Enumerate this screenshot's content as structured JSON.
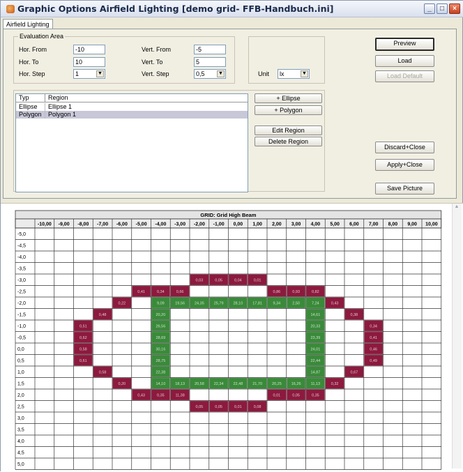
{
  "window": {
    "title": "Graphic Options Airfield Lighting [demo grid- FFB-Handbuch.ini]"
  },
  "tab": "Airfield Lighting",
  "evaluation": {
    "legend": "Evaluation Area",
    "hor_from_label": "Hor. From",
    "hor_from": "-10",
    "hor_to_label": "Hor. To",
    "hor_to": "10",
    "hor_step_label": "Hor. Step",
    "hor_step": "1",
    "vert_from_label": "Vert. From",
    "vert_from": "-5",
    "vert_to_label": "Vert. To",
    "vert_to": "5",
    "vert_step_label": "Vert. Step",
    "vert_step": "0,5",
    "unit_label": "Unit",
    "unit": "lx"
  },
  "regions": {
    "columns": [
      "Typ",
      "Region"
    ],
    "rows": [
      {
        "typ": "Ellipse",
        "region": "Ellipse 1",
        "selected": false
      },
      {
        "typ": "Polygon",
        "region": "Polygon 1",
        "selected": true
      }
    ],
    "add_ellipse": "+ Ellipse",
    "add_polygon": "+ Polygon",
    "edit_region": "Edit Region",
    "delete_region": "Delete Region"
  },
  "buttons": {
    "preview": "Preview",
    "load": "Load",
    "load_default": "Load Default",
    "discard_close": "Discard+Close",
    "apply_close": "Apply+Close",
    "save_picture": "Save Picture"
  },
  "icons": {
    "app": "app-icon",
    "minimize": "minimize-icon",
    "maximize": "maximize-icon",
    "close": "close-icon",
    "dropdown": "chevron-down-icon"
  },
  "colors": {
    "maroon": "#8c1a3e",
    "green": "#3a8a3a"
  },
  "grid": {
    "title": "GRID: Grid High Beam",
    "x_labels": [
      "-10,00",
      "-9,00",
      "-8,00",
      "-7,00",
      "-6,00",
      "-5,00",
      "-4,00",
      "-3,00",
      "-2,00",
      "-1,00",
      "0,00",
      "1,00",
      "2,00",
      "3,00",
      "4,00",
      "5,00",
      "6,00",
      "7,00",
      "8,00",
      "9,00",
      "10,00"
    ],
    "y_labels": [
      "-5,0",
      "-4,5",
      "-4,0",
      "-3,5",
      "-3,0",
      "-2,5",
      "-2,0",
      "-1,5",
      "-1,0",
      "-0,5",
      "0,0",
      "0,5",
      "1,0",
      "1,5",
      "2,0",
      "2,5",
      "3,0",
      "3,5",
      "4,0",
      "4,5",
      "5,0"
    ],
    "green_cells": [
      {
        "row": 6,
        "col": 6,
        "value": "9,09"
      },
      {
        "row": 6,
        "col": 7,
        "value": "19,56"
      },
      {
        "row": 6,
        "col": 8,
        "value": "24,35"
      },
      {
        "row": 6,
        "col": 9,
        "value": "25,79"
      },
      {
        "row": 6,
        "col": 10,
        "value": "28,10"
      },
      {
        "row": 6,
        "col": 11,
        "value": "17,81"
      },
      {
        "row": 6,
        "col": 12,
        "value": "9,34"
      },
      {
        "row": 6,
        "col": 13,
        "value": "2,50"
      },
      {
        "row": 6,
        "col": 14,
        "value": "7,24"
      },
      {
        "row": 7,
        "col": 6,
        "value": "20,20"
      },
      {
        "row": 7,
        "col": 14,
        "value": "14,61"
      },
      {
        "row": 8,
        "col": 6,
        "value": "26,56"
      },
      {
        "row": 8,
        "col": 14,
        "value": "20,33"
      },
      {
        "row": 9,
        "col": 6,
        "value": "28,69"
      },
      {
        "row": 9,
        "col": 14,
        "value": "23,39"
      },
      {
        "row": 10,
        "col": 6,
        "value": "30,16"
      },
      {
        "row": 10,
        "col": 14,
        "value": "24,01"
      },
      {
        "row": 11,
        "col": 6,
        "value": "28,75"
      },
      {
        "row": 11,
        "col": 14,
        "value": "22,44"
      },
      {
        "row": 12,
        "col": 6,
        "value": "22,38"
      },
      {
        "row": 12,
        "col": 14,
        "value": "14,87"
      },
      {
        "row": 13,
        "col": 6,
        "value": "14,10"
      },
      {
        "row": 13,
        "col": 7,
        "value": "18,13"
      },
      {
        "row": 13,
        "col": 8,
        "value": "20,58"
      },
      {
        "row": 13,
        "col": 9,
        "value": "22,34"
      },
      {
        "row": 13,
        "col": 10,
        "value": "22,48"
      },
      {
        "row": 13,
        "col": 11,
        "value": "21,70"
      },
      {
        "row": 13,
        "col": 12,
        "value": "20,25"
      },
      {
        "row": 13,
        "col": 13,
        "value": "16,26"
      },
      {
        "row": 13,
        "col": 14,
        "value": "11,13"
      }
    ],
    "maroon_cells": [
      {
        "row": 4,
        "col": 8,
        "value": "0,03"
      },
      {
        "row": 4,
        "col": 9,
        "value": "0,05"
      },
      {
        "row": 4,
        "col": 10,
        "value": "0,04"
      },
      {
        "row": 4,
        "col": 11,
        "value": "0,01"
      },
      {
        "row": 5,
        "col": 5,
        "value": "0,41"
      },
      {
        "row": 5,
        "col": 6,
        "value": "0,34"
      },
      {
        "row": 5,
        "col": 7,
        "value": "0,66"
      },
      {
        "row": 5,
        "col": 12,
        "value": "0,86"
      },
      {
        "row": 5,
        "col": 13,
        "value": "0,93"
      },
      {
        "row": 5,
        "col": 14,
        "value": "0,82"
      },
      {
        "row": 6,
        "col": 4,
        "value": "0,22"
      },
      {
        "row": 6,
        "col": 15,
        "value": "0,43"
      },
      {
        "row": 7,
        "col": 3,
        "value": "0,48"
      },
      {
        "row": 7,
        "col": 16,
        "value": "0,38"
      },
      {
        "row": 8,
        "col": 2,
        "value": "0,51"
      },
      {
        "row": 8,
        "col": 17,
        "value": "0,34"
      },
      {
        "row": 9,
        "col": 2,
        "value": "0,62"
      },
      {
        "row": 9,
        "col": 17,
        "value": "0,41"
      },
      {
        "row": 10,
        "col": 2,
        "value": "0,58"
      },
      {
        "row": 10,
        "col": 17,
        "value": "0,46"
      },
      {
        "row": 11,
        "col": 2,
        "value": "0,61"
      },
      {
        "row": 11,
        "col": 17,
        "value": "0,49"
      },
      {
        "row": 12,
        "col": 3,
        "value": "0,58"
      },
      {
        "row": 12,
        "col": 16,
        "value": "0,67"
      },
      {
        "row": 13,
        "col": 4,
        "value": "0,20"
      },
      {
        "row": 13,
        "col": 15,
        "value": "0,32"
      },
      {
        "row": 14,
        "col": 5,
        "value": "0,43"
      },
      {
        "row": 14,
        "col": 6,
        "value": "0,35"
      },
      {
        "row": 14,
        "col": 7,
        "value": "11,38"
      },
      {
        "row": 14,
        "col": 12,
        "value": "0,01"
      },
      {
        "row": 14,
        "col": 13,
        "value": "0,05"
      },
      {
        "row": 14,
        "col": 14,
        "value": "0,35"
      },
      {
        "row": 15,
        "col": 8,
        "value": "0,05"
      },
      {
        "row": 15,
        "col": 9,
        "value": "0,05"
      },
      {
        "row": 15,
        "col": 10,
        "value": "0,01"
      },
      {
        "row": 15,
        "col": 11,
        "value": "0,08"
      }
    ]
  }
}
